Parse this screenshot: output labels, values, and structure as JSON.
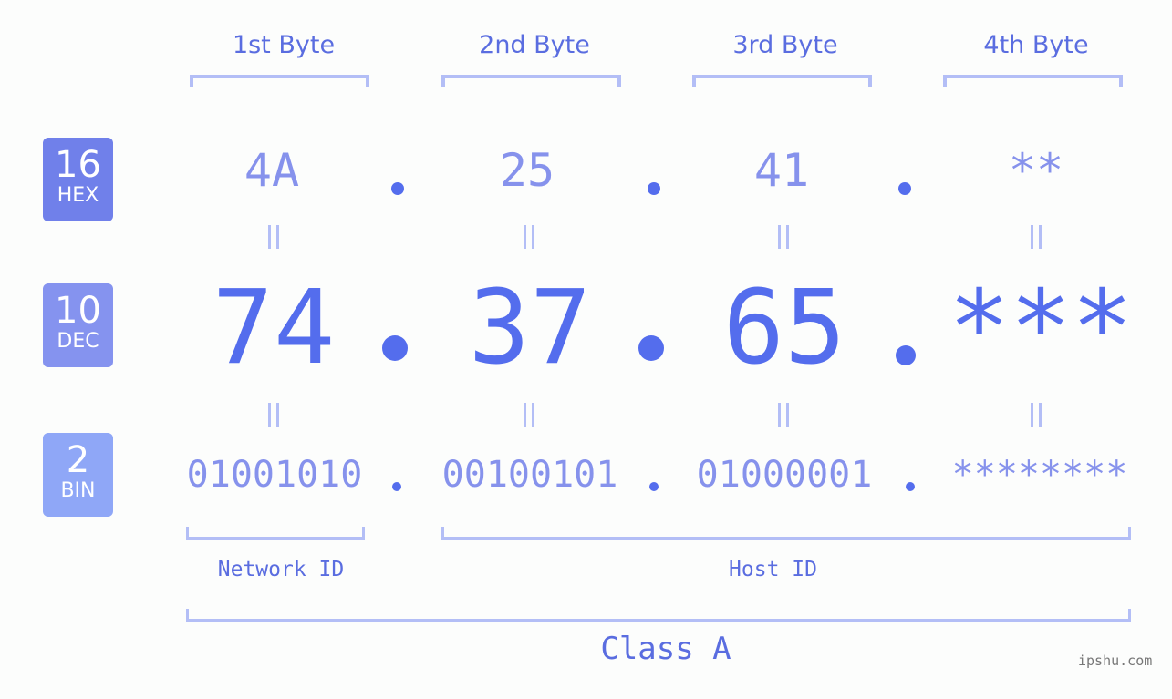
{
  "byte_headers": [
    "1st Byte",
    "2nd Byte",
    "3rd Byte",
    "4th Byte"
  ],
  "badges": [
    {
      "base": "16",
      "label": "HEX",
      "color": "#7080ea"
    },
    {
      "base": "10",
      "label": "DEC",
      "color": "#8593ef"
    },
    {
      "base": "2",
      "label": "BIN",
      "color": "#8fa7f7"
    }
  ],
  "hex": [
    "4A",
    "25",
    "41",
    "**"
  ],
  "dec": [
    "74",
    "37",
    "65",
    "***"
  ],
  "bin": [
    "01001010",
    "00100101",
    "01000001",
    "********"
  ],
  "separator": ".",
  "equals_symbol": "=",
  "network_id_label": "Network ID",
  "host_id_label": "Host ID",
  "class_label": "Class A",
  "watermark": "ipshu.com",
  "colors": {
    "primary": "#546ded",
    "light": "#8692ec",
    "bracket": "#b3bef6",
    "background": "#fcfdfc"
  }
}
